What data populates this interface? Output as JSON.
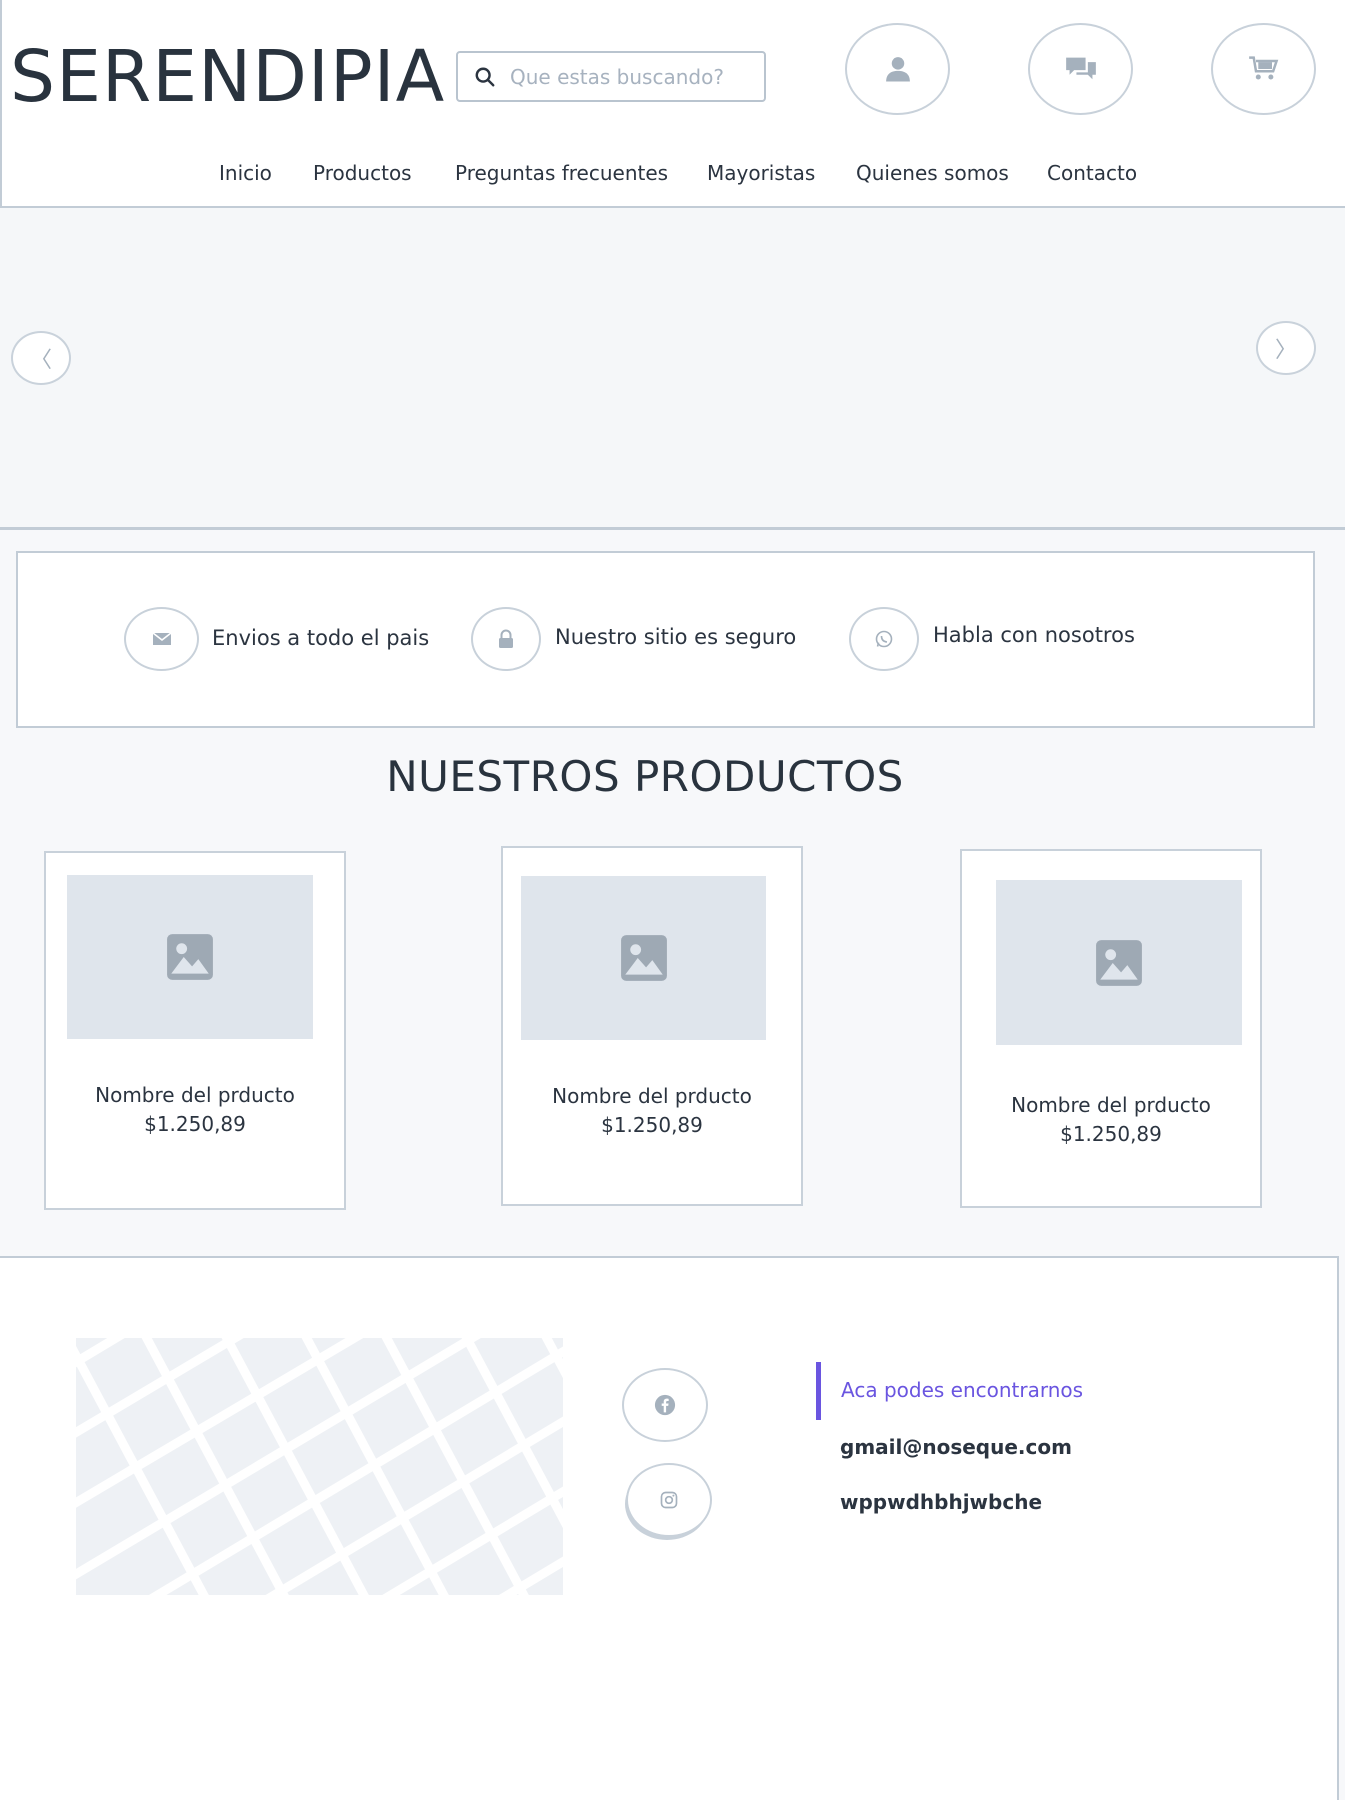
{
  "header": {
    "logo": "SERENDIPIA",
    "search_placeholder": "Que estas buscando?",
    "actions": [
      {
        "name": "user-icon"
      },
      {
        "name": "chat-icon"
      },
      {
        "name": "cart-icon"
      }
    ]
  },
  "nav": {
    "items": [
      "Inicio",
      "Productos",
      "Preguntas frecuentes",
      "Mayoristas",
      "Quienes somos",
      "Contacto"
    ]
  },
  "hero": {
    "prev_arrow": "〈",
    "next_arrow": "〉"
  },
  "features": [
    {
      "icon": "envelope-icon",
      "label": "Envios a todo el pais"
    },
    {
      "icon": "lock-icon",
      "label": "Nuestro sitio es seguro"
    },
    {
      "icon": "whatsapp-icon",
      "label": "Habla con nosotros"
    }
  ],
  "products": {
    "title": "NUESTROS PRODUCTOS",
    "items": [
      {
        "name": "Nombre del prducto",
        "price": "$1.250,89"
      },
      {
        "name": "Nombre del prducto",
        "price": "$1.250,89"
      },
      {
        "name": "Nombre del prducto",
        "price": "$1.250,89"
      }
    ]
  },
  "footer": {
    "social": [
      {
        "icon": "facebook-icon"
      },
      {
        "icon": "instagram-icon"
      }
    ],
    "contact_heading": "Aca podes encontrarnos",
    "email": "gmail@noseque.com",
    "phone": "wppwdhbhjwbche"
  },
  "colors": {
    "accent": "#6a55e0",
    "border": "#c2ccd6",
    "icon": "#a5b1bd",
    "placeholder_bg": "#dfe5ec",
    "text": "#2b3440"
  }
}
